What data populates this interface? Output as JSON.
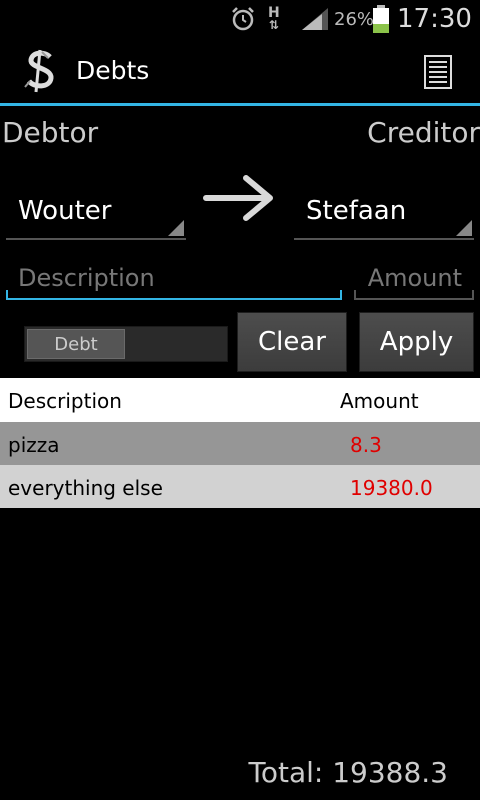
{
  "status_bar": {
    "alarm_icon": "alarm-clock-icon",
    "network_h": "H",
    "network_arrows": "⇅",
    "signal_icon": "signal-icon",
    "battery_percent": "26%",
    "battery_icon": "battery-icon",
    "battery_level": 0.26,
    "time": "17:30"
  },
  "action_bar": {
    "title": "Debts",
    "app_icon": "dollar-logo-icon",
    "menu_icon": "list-menu-icon",
    "accent_color": "#33b5e5"
  },
  "form": {
    "debtor_label": "Debtor",
    "creditor_label": "Creditor",
    "debtor_value": "Wouter",
    "creditor_value": "Stefaan",
    "arrow_icon": "right-arrow-icon",
    "description_placeholder": "Description",
    "description_value": "",
    "amount_placeholder": "Amount",
    "amount_value": "",
    "toggle_label": "Debt",
    "clear_label": "Clear",
    "apply_label": "Apply"
  },
  "table": {
    "headers": [
      "Description",
      "Amount"
    ],
    "rows": [
      {
        "description": "pizza",
        "amount": "8.3"
      },
      {
        "description": "everything else",
        "amount": "19380.0"
      }
    ]
  },
  "total": "Total: 19388.3"
}
